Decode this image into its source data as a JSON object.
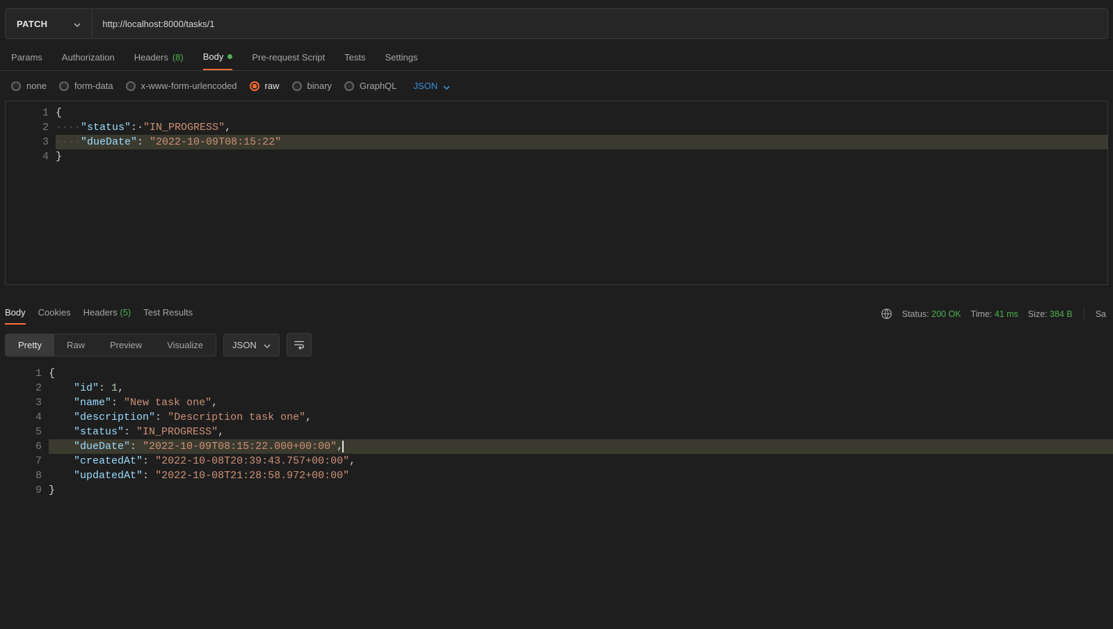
{
  "request": {
    "method": "PATCH",
    "url": "http://localhost:8000/tasks/1"
  },
  "tabs": {
    "params": "Params",
    "auth": "Authorization",
    "headers_label": "Headers",
    "headers_count": "(8)",
    "body": "Body",
    "pre": "Pre-request Script",
    "tests": "Tests",
    "settings": "Settings"
  },
  "body_types": {
    "none": "none",
    "formdata": "form-data",
    "xwww": "x-www-form-urlencoded",
    "raw": "raw",
    "binary": "binary",
    "graphql": "GraphQL",
    "json": "JSON"
  },
  "req_body": {
    "l1": "{",
    "l2_indent": "····",
    "l2_key": "\"status\"",
    "l2_colon": ":·",
    "l2_val": "\"IN_PROGRESS\"",
    "l2_comma": ",",
    "l3_indent": "····",
    "l3_key": "\"dueDate\"",
    "l3_colon": ": ",
    "l3_val": "\"2022-10-09T08:15:22\"",
    "l4": "}"
  },
  "resp_tabs": {
    "body": "Body",
    "cookies": "Cookies",
    "headers_label": "Headers",
    "headers_count": "(5)",
    "tests": "Test Results"
  },
  "resp_meta": {
    "status_label": "Status:",
    "status_value": "200 OK",
    "time_label": "Time:",
    "time_value": "41 ms",
    "size_label": "Size:",
    "size_value": "384 B",
    "save": "Sa"
  },
  "view": {
    "pretty": "Pretty",
    "raw": "Raw",
    "preview": "Preview",
    "visualize": "Visualize",
    "json": "JSON"
  },
  "resp_body": {
    "l1": "{",
    "l2_key": "\"id\"",
    "l2_colon": ": ",
    "l2_val": "1",
    "l2_comma": ",",
    "l3_key": "\"name\"",
    "l3_colon": ": ",
    "l3_val": "\"New task one\"",
    "l3_comma": ",",
    "l4_key": "\"description\"",
    "l4_colon": ": ",
    "l4_val": "\"Description task one\"",
    "l4_comma": ",",
    "l5_key": "\"status\"",
    "l5_colon": ": ",
    "l5_val": "\"IN_PROGRESS\"",
    "l5_comma": ",",
    "l6_key": "\"dueDate\"",
    "l6_colon": ": ",
    "l6_val": "\"2022-10-09T08:15:22.000+00:00\"",
    "l6_comma": ",",
    "l7_key": "\"createdAt\"",
    "l7_colon": ": ",
    "l7_val": "\"2022-10-08T20:39:43.757+00:00\"",
    "l7_comma": ",",
    "l8_key": "\"updatedAt\"",
    "l8_colon": ": ",
    "l8_val": "\"2022-10-08T21:28:58.972+00:00\"",
    "l9": "}"
  }
}
